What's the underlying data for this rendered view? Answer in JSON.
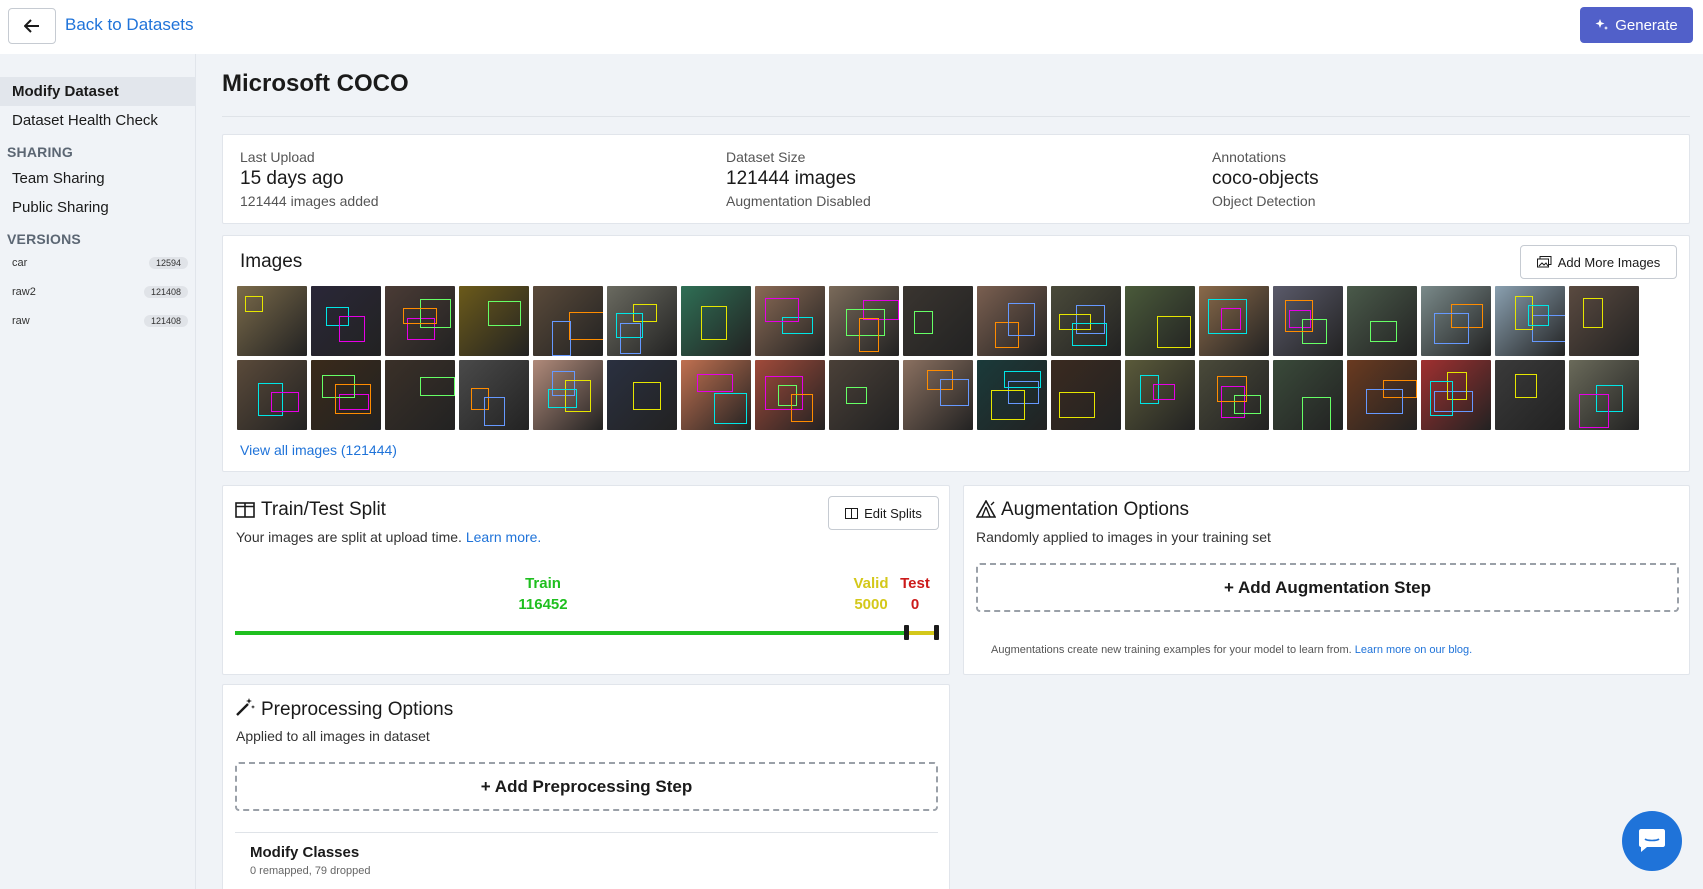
{
  "topbar": {
    "back_label": "Back to Datasets",
    "generate_label": "Generate"
  },
  "sidebar": {
    "items": [
      {
        "label": "Modify Dataset"
      },
      {
        "label": "Dataset Health Check"
      },
      {
        "label": "Team Sharing"
      },
      {
        "label": "Public Sharing"
      }
    ],
    "sharing_heading": "SHARING",
    "versions_heading": "VERSIONS",
    "versions": [
      {
        "name": "car",
        "count": "12594"
      },
      {
        "name": "raw2",
        "count": "121408"
      },
      {
        "name": "raw",
        "count": "121408"
      }
    ]
  },
  "page": {
    "title": "Microsoft COCO"
  },
  "stats": {
    "last_upload": {
      "label": "Last Upload",
      "value": "15 days ago",
      "sub": "121444 images added"
    },
    "dataset_size": {
      "label": "Dataset Size",
      "value": "121444 images",
      "sub": "Augmentation Disabled"
    },
    "annotations": {
      "label": "Annotations",
      "value": "coco-objects",
      "sub": "Object Detection"
    }
  },
  "images": {
    "title": "Images",
    "add_more_label": "Add More Images",
    "view_all_label": "View all images (121444)",
    "thumb_colors": [
      "#7a6a4a",
      "#2a2738",
      "#4a3b35",
      "#6b5a1a",
      "#5a4a3a",
      "#6a6a60",
      "#2f6f55",
      "#8a6a55",
      "#7a6a5a",
      "#3a3530",
      "#7a5f50",
      "#4a4a3a",
      "#4a5a3a",
      "#8a6a4a",
      "#5a5a6a",
      "#4a5a4a",
      "#7a8a8a",
      "#8aa0b0",
      "#5a4a40",
      "#5a4a3a",
      "#3a2a1a",
      "#3a3028",
      "#4a4a4a",
      "#b08a7a",
      "#2a3040",
      "#c07050",
      "#a04a3a",
      "#4a4038",
      "#8a7060",
      "#1a3a3a",
      "#3a2a20",
      "#5a5a3a",
      "#4a4a3a",
      "#3a4a3a",
      "#6a3a20",
      "#a03030",
      "#3a3a3a",
      "#6a6a5a"
    ]
  },
  "split": {
    "title": "Train/Test Split",
    "edit_label": "Edit Splits",
    "desc": "Your images are split at upload time.",
    "learn_more": "Learn more.",
    "train_label": "Train",
    "train_value": "116452",
    "valid_label": "Valid",
    "valid_value": "5000",
    "test_label": "Test",
    "test_value": "0",
    "train_color": "#1fbf1f",
    "valid_color": "#d4c81a",
    "test_color": "#cc1a1a"
  },
  "augmentation": {
    "title": "Augmentation Options",
    "desc": "Randomly applied to images in your training set",
    "add_label": "+ Add Augmentation Step",
    "note": "Augmentations create new training examples for your model to learn from.",
    "note_link": "Learn more on our blog."
  },
  "preprocessing": {
    "title": "Preprocessing Options",
    "desc": "Applied to all images in dataset",
    "add_label": "+ Add Preprocessing Step",
    "modify_title": "Modify Classes",
    "modify_sub": "0 remapped, 79 dropped"
  }
}
